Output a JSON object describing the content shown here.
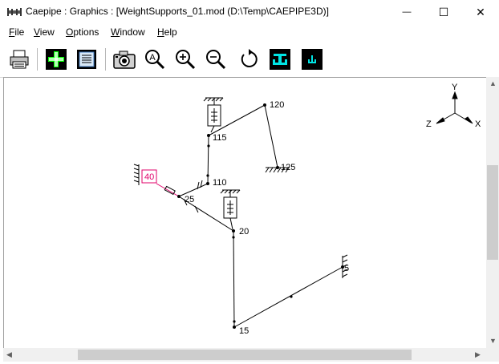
{
  "window": {
    "app_name": "Caepipe",
    "title": "Caepipe : Graphics :  [WeightSupports_01.mod (D:\\Temp\\CAEPIPE3D)]",
    "minimize_glyph": "—",
    "maximize_glyph": "☐",
    "close_glyph": "✕"
  },
  "menu": {
    "file": {
      "underline": "F",
      "rest": "ile"
    },
    "view": {
      "underline": "V",
      "rest": "iew"
    },
    "options": {
      "underline": "O",
      "rest": "ptions"
    },
    "window": {
      "underline": "W",
      "rest": "indow"
    },
    "help": {
      "underline": "H",
      "rest": "elp"
    }
  },
  "toolbar": {
    "icons": [
      "printer-icon",
      "add-icon",
      "list-view-icon",
      "camera-icon",
      "zoom-all-icon",
      "zoom-in-icon",
      "zoom-out-icon",
      "rotate-icon",
      "supports-icon",
      "hangers-icon"
    ],
    "zoom_all_letter": "A"
  },
  "axes": {
    "y": "Y",
    "z": "Z",
    "x": "X"
  },
  "nodes": {
    "n120": "120",
    "n115": "115",
    "n125": "125",
    "n110": "110",
    "n40": "40",
    "n25": "25",
    "n20": "20",
    "n15": "15",
    "n5": "5"
  },
  "colors": {
    "highlight": "#e0006a",
    "pipe": "#000000"
  },
  "scroll": {
    "up": "▲",
    "down": "▼",
    "left": "◀",
    "right": "▶"
  }
}
